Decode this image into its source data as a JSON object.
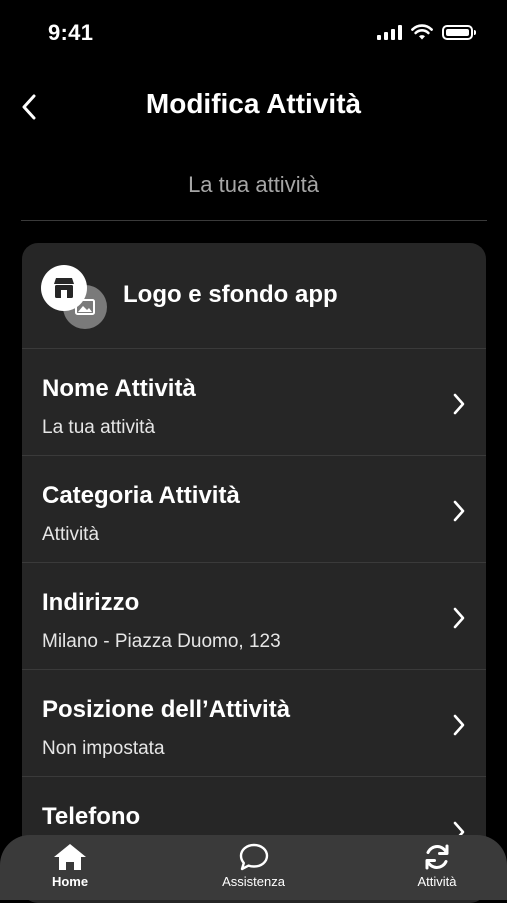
{
  "status_bar": {
    "time": "9:41"
  },
  "header": {
    "title": "Modifica Attività"
  },
  "section": {
    "title": "La tua attività"
  },
  "logo_row": {
    "label": "Logo e sfondo app"
  },
  "rows": [
    {
      "title": "Nome Attività",
      "value": "La tua attività"
    },
    {
      "title": "Categoria Attività",
      "value": "Attività"
    },
    {
      "title": "Indirizzo",
      "value": "Milano - Piazza Duomo, 123"
    },
    {
      "title": "Posizione dell’Attività",
      "value": "Non impostata"
    },
    {
      "title": "Telefono",
      "value": ""
    }
  ],
  "tab_bar": {
    "tabs": [
      {
        "label": "Home",
        "icon": "home-icon"
      },
      {
        "label": "Assistenza",
        "icon": "chat-bubble-icon"
      },
      {
        "label": "Attività",
        "icon": "refresh-icon"
      }
    ]
  },
  "colors": {
    "background": "#000000",
    "card": "#262626",
    "tab_bar": "#3a3a3a",
    "muted_text": "#a6a6a6"
  }
}
